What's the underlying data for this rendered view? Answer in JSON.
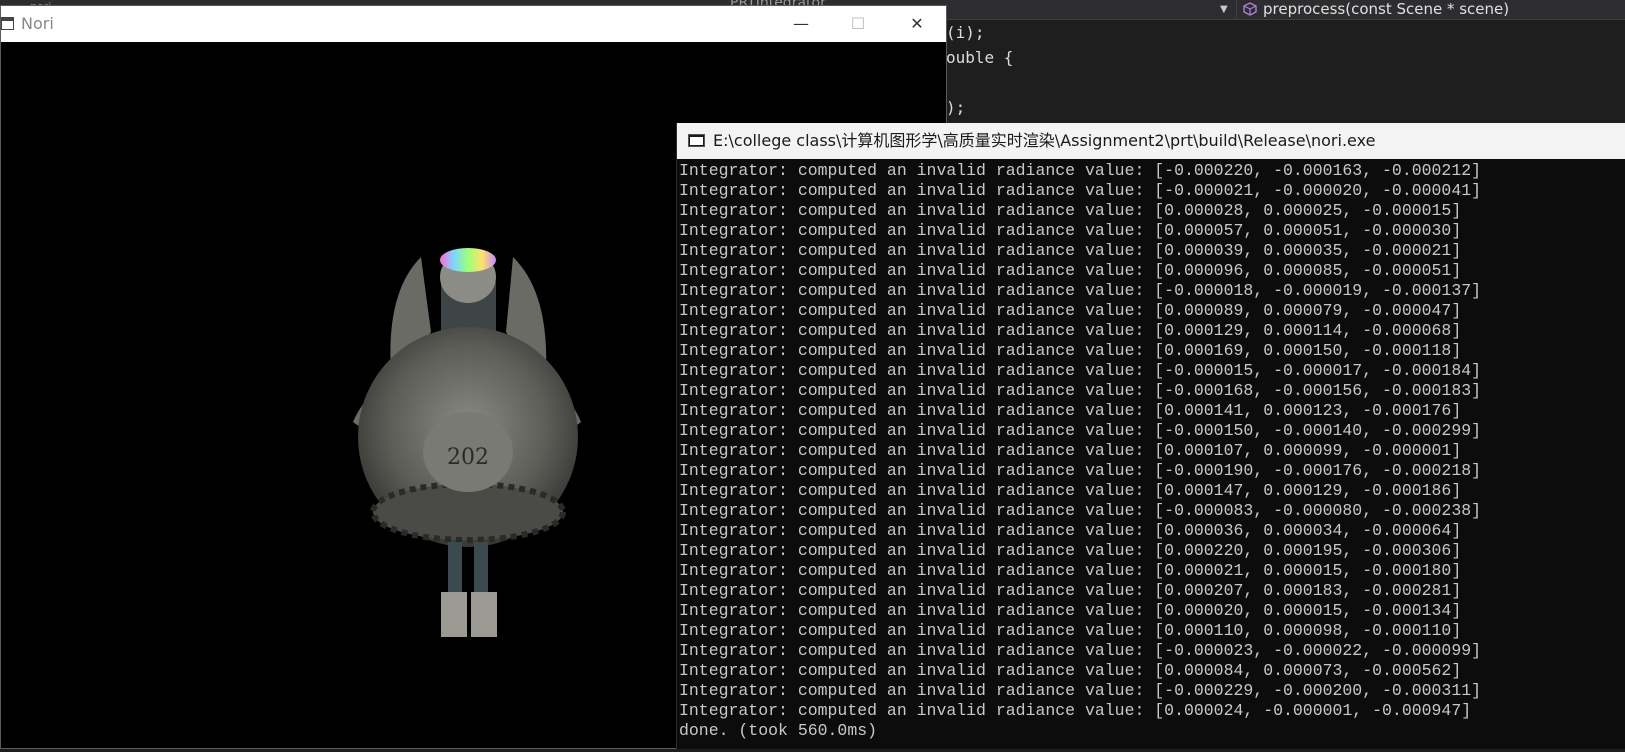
{
  "ide": {
    "top_left_tab": "nori",
    "class_dropdown": "PRTIntegrator",
    "function_dropdown": {
      "label": "preprocess(const Scene * scene)",
      "icon": "method-cube-icon"
    },
    "code_lines": [
      {
        "text": "(i);"
      },
      {
        "text": "ouble {"
      },
      {
        "text": ""
      },
      {
        "text": ");"
      }
    ]
  },
  "nori_window": {
    "title": "Nori",
    "minimize": "—",
    "maximize": "☐",
    "close": "✕",
    "render_text": "202"
  },
  "console": {
    "title": "E:\\college class\\计算机图形学\\高质量实时渲染\\Assignment2\\prt\\build\\Release\\nori.exe",
    "lines": [
      "Integrator: computed an invalid radiance value: [-0.000220, -0.000163, -0.000212]",
      "Integrator: computed an invalid radiance value: [-0.000021, -0.000020, -0.000041]",
      "Integrator: computed an invalid radiance value: [0.000028, 0.000025, -0.000015]",
      "Integrator: computed an invalid radiance value: [0.000057, 0.000051, -0.000030]",
      "Integrator: computed an invalid radiance value: [0.000039, 0.000035, -0.000021]",
      "Integrator: computed an invalid radiance value: [0.000096, 0.000085, -0.000051]",
      "Integrator: computed an invalid radiance value: [-0.000018, -0.000019, -0.000137]",
      "Integrator: computed an invalid radiance value: [0.000089, 0.000079, -0.000047]",
      "Integrator: computed an invalid radiance value: [0.000129, 0.000114, -0.000068]",
      "Integrator: computed an invalid radiance value: [0.000169, 0.000150, -0.000118]",
      "Integrator: computed an invalid radiance value: [-0.000015, -0.000017, -0.000184]",
      "Integrator: computed an invalid radiance value: [-0.000168, -0.000156, -0.000183]",
      "Integrator: computed an invalid radiance value: [0.000141, 0.000123, -0.000176]",
      "Integrator: computed an invalid radiance value: [-0.000150, -0.000140, -0.000299]",
      "Integrator: computed an invalid radiance value: [0.000107, 0.000099, -0.000001]",
      "Integrator: computed an invalid radiance value: [-0.000190, -0.000176, -0.000218]",
      "Integrator: computed an invalid radiance value: [0.000147, 0.000129, -0.000186]",
      "Integrator: computed an invalid radiance value: [-0.000083, -0.000080, -0.000238]",
      "Integrator: computed an invalid radiance value: [0.000036, 0.000034, -0.000064]",
      "Integrator: computed an invalid radiance value: [0.000220, 0.000195, -0.000306]",
      "Integrator: computed an invalid radiance value: [0.000021, 0.000015, -0.000180]",
      "Integrator: computed an invalid radiance value: [0.000207, 0.000183, -0.000281]",
      "Integrator: computed an invalid radiance value: [0.000020, 0.000015, -0.000134]",
      "Integrator: computed an invalid radiance value: [0.000110, 0.000098, -0.000110]",
      "Integrator: computed an invalid radiance value: [-0.000023, -0.000022, -0.000099]",
      "Integrator: computed an invalid radiance value: [0.000084, 0.000073, -0.000562]",
      "Integrator: computed an invalid radiance value: [-0.000229, -0.000200, -0.000311]",
      "Integrator: computed an invalid radiance value: [0.000024, -0.000001, -0.000947]",
      "done. (took 560.0ms)"
    ]
  },
  "colors": {
    "ide_bg": "#1e1e1e",
    "console_bg": "#0c0c0c",
    "console_text": "#c8c8c8",
    "render_bg": "#000000"
  }
}
